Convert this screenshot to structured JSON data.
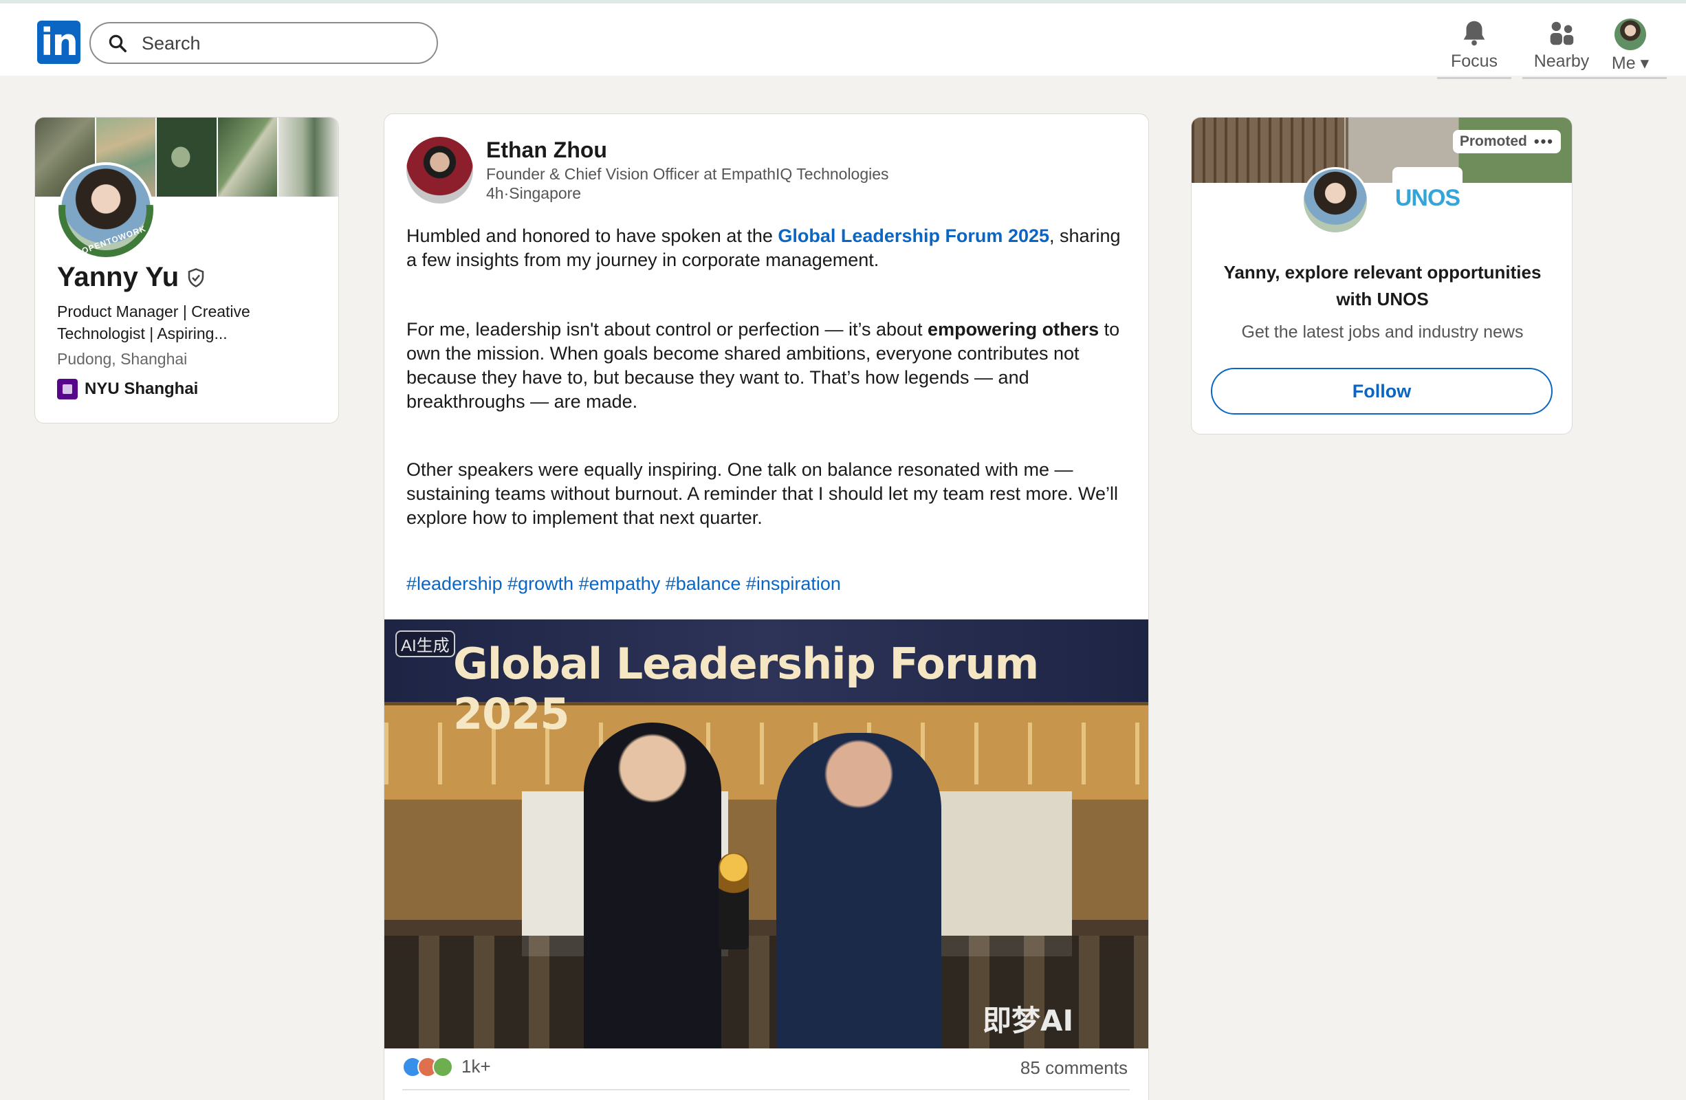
{
  "header": {
    "logo_text": "in",
    "search_placeholder": "Search",
    "nav": [
      {
        "label": "Focus",
        "icon": "bell-icon"
      },
      {
        "label": "Nearby",
        "icon": "people-icon"
      },
      {
        "label": "Me",
        "icon": "avatar-icon"
      }
    ]
  },
  "profile": {
    "name": "Yanny Yu",
    "verified": true,
    "badge_text": "#OPENTOWORK",
    "headline": "Product Manager | Creative Technologist | Aspiring...",
    "location": "Pudong, Shanghai",
    "school": "NYU Shanghai"
  },
  "post": {
    "author_name": "Ethan Zhou",
    "author_title": "Founder & Chief Vision Officer at EmpathIQ Technologies",
    "author_meta": "4h·Singapore",
    "p1_before": "Humbled and honored to have spoken at the ",
    "p1_link": "Global Leadership Forum 2025",
    "p1_after": ", sharing a few insights from my journey in corporate management.",
    "p2_before": "For me, leadership isn't about control or perfection — it’s about ",
    "p2_bold": "empowering others",
    "p2_after": " to own the mission. When goals become shared ambitions, everyone contributes not because they have to, but because they want to. That’s how legends — and breakthroughs — are made.",
    "p3": "Other speakers were equally inspiring. One talk on balance resonated with me — sustaining teams without burnout. A reminder that I should let my team rest more. We’ll explore how to implement that next quarter.",
    "hashtags": "#leadership #growth #empathy #balance #inspiration",
    "image": {
      "ai_label": "AI生成",
      "banner_text": "Global Leadership Forum 2025",
      "watermark": "即梦AI"
    },
    "reaction_count": "1k+",
    "comments": "85 comments"
  },
  "ad": {
    "promoted_label": "Promoted",
    "more": "•••",
    "brand": "UNOS",
    "headline": "Yanny, explore relevant opportunities with UNOS",
    "subtext": "Get the latest jobs and industry news",
    "follow_label": "Follow"
  },
  "colors": {
    "linkedin_blue": "#0a66c2",
    "background": "#f3f2ef",
    "open_to_work_green": "#3f7a3a"
  }
}
